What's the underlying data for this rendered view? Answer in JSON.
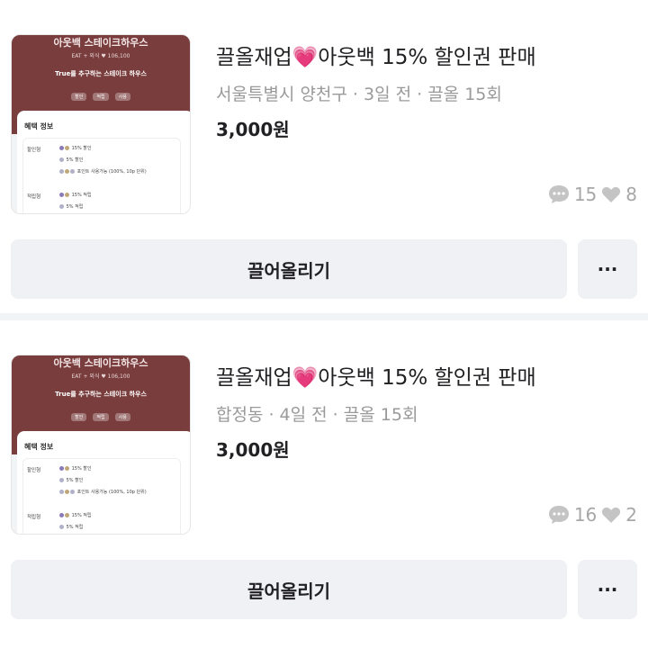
{
  "listings": [
    {
      "thumb": {
        "store": "아웃백 스테이크하우스",
        "sub": "EAT + 외식   ♥ 106,100",
        "tagline": "True를 추구하는 스테이크 하우스",
        "chips": [
          "할인",
          "적립",
          "사용"
        ],
        "benefit_title": "혜택 정보",
        "discount_label": "할인형",
        "discount_rows": [
          "15% 할인",
          "5% 할인",
          "포인트 사용가능 (100%, 10p 단위)"
        ],
        "reward_label": "적립형",
        "reward_rows": [
          "15% 적립",
          "5% 적립"
        ]
      },
      "title_before": "끌올재업",
      "title_emoji": "💗",
      "title_after": "아웃백 15% 할인권 판매",
      "meta": "서울특별시 양천구 · 3일 전 · 끌올 15회",
      "price": "3,000원",
      "comments": "15",
      "likes": "8",
      "bump_label": "끌어올리기",
      "more_label": "···"
    },
    {
      "thumb": {
        "store": "아웃백 스테이크하우스",
        "sub": "EAT + 외식   ♥ 106,100",
        "tagline": "True를 추구하는 스테이크 하우스",
        "chips": [
          "할인",
          "적립",
          "사용"
        ],
        "benefit_title": "혜택 정보",
        "discount_label": "할인형",
        "discount_rows": [
          "15% 할인",
          "5% 할인",
          "포인트 사용가능 (100%, 10p 단위)"
        ],
        "reward_label": "적립형",
        "reward_rows": [
          "15% 적립",
          "5% 적립"
        ]
      },
      "title_before": "끌올재업",
      "title_emoji": "💗",
      "title_after": "아웃백 15% 할인권 판매",
      "meta": "합정동 · 4일 전 · 끌올 15회",
      "price": "3,000원",
      "comments": "16",
      "likes": "2",
      "bump_label": "끌어올리기",
      "more_label": "···"
    }
  ],
  "icons": {
    "comment": "speech-bubble-icon",
    "like": "heart-outline-icon"
  }
}
